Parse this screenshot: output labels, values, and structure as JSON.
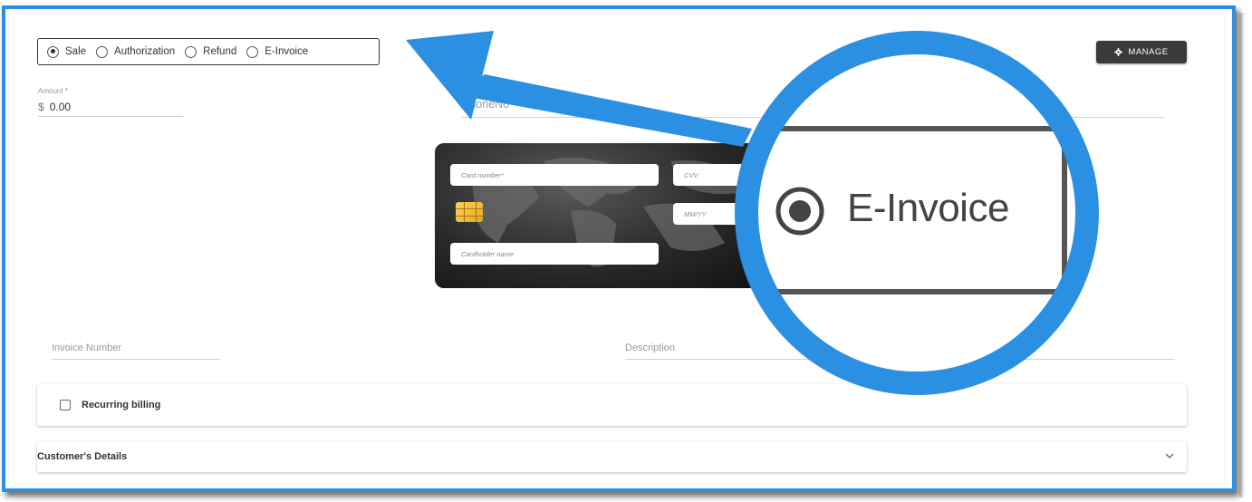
{
  "transaction_types": [
    {
      "label": "Sale",
      "checked": true
    },
    {
      "label": "Authorization",
      "checked": false
    },
    {
      "label": "Refund",
      "checked": false
    },
    {
      "label": "E-Invoice",
      "checked": false
    }
  ],
  "manage_button": {
    "label": "MANAGE",
    "icon": "gear-icon"
  },
  "amount": {
    "label": "Amount *",
    "currency": "$",
    "value": "0.00"
  },
  "phone": {
    "placeholder": "PhoneNo"
  },
  "card": {
    "number_placeholder": "Card number*",
    "cvv_placeholder": "CVV",
    "expiry_placeholder": "MM/YY",
    "holder_placeholder": "Cardholder name"
  },
  "invoice_number": {
    "placeholder": "Invoice Number"
  },
  "description": {
    "placeholder": "Description"
  },
  "recurring": {
    "label": "Recurring billing",
    "checked": false
  },
  "customer_details": {
    "label": "Customer's Details",
    "icon": "chevron-down-icon"
  },
  "zoom_callout": {
    "label": "E-Invoice",
    "checked": true
  },
  "colors": {
    "accent_blue": "#2b8fe2",
    "button_dark": "#3a3a3a"
  }
}
